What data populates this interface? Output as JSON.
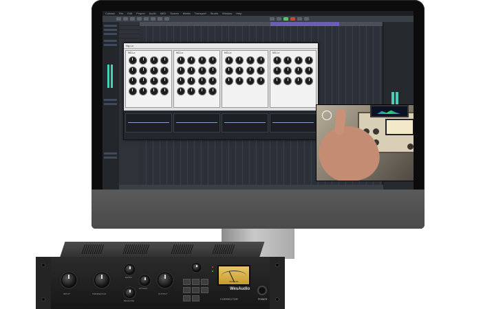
{
  "daw": {
    "menu": [
      "Cubase",
      "File",
      "Edit",
      "Project",
      "Audio",
      "MIDI",
      "Scores",
      "Media",
      "Transport",
      "Studio",
      "Window",
      "Help"
    ],
    "plugin_window_title": "Ng-Lo",
    "plugin_units": [
      "NG-Lo",
      "NG-Lo",
      "NG-Lo",
      "NG-Lo"
    ]
  },
  "rack_unit": {
    "brand": "WesAudio",
    "model": "CORRECTOR",
    "power_label": "POWER",
    "knob_labels": [
      "INPUT",
      "THRESHOLD",
      "RATIO",
      "ATTACK",
      "RELEASE",
      "OUTPUT"
    ],
    "vu_label": "WesAudio"
  },
  "colors": {
    "meter": "#48d0b6",
    "loop": "#6b5fb5",
    "transport_active": "#56c46a"
  }
}
